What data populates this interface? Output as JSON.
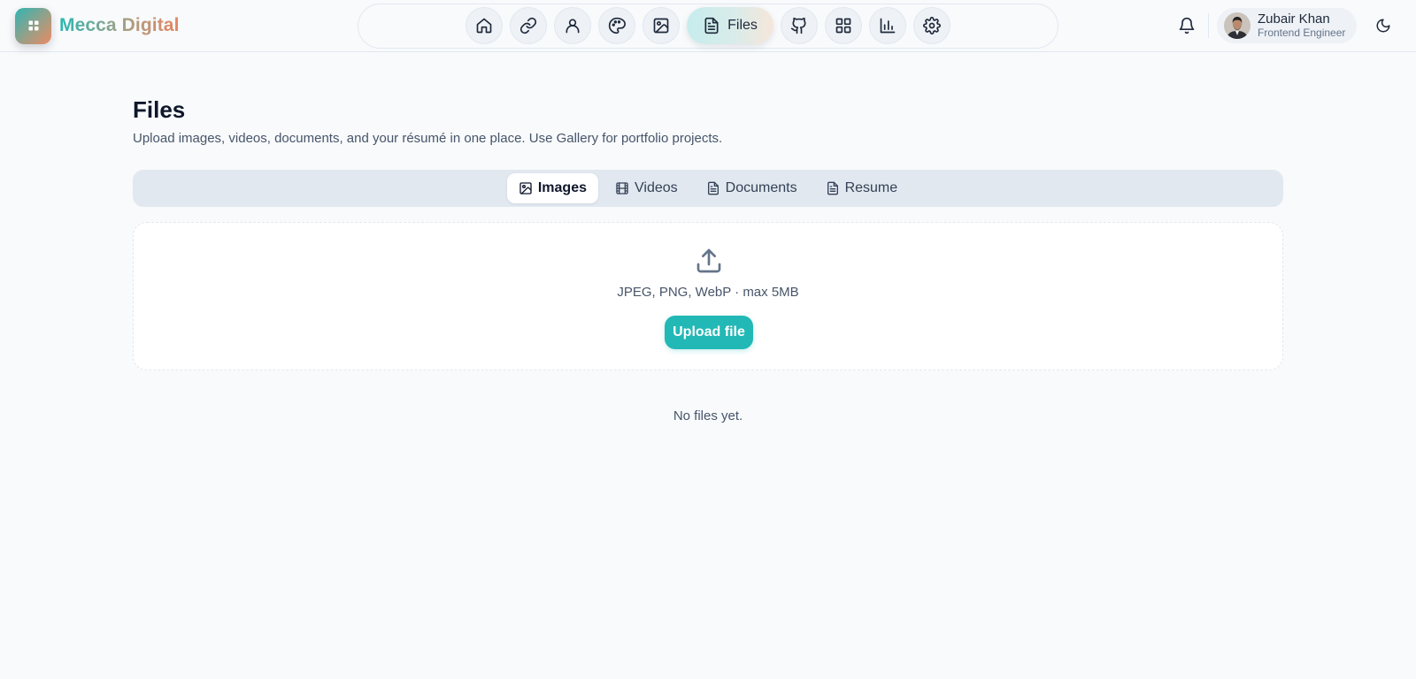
{
  "brand": {
    "name": "Mecca Digital",
    "logo_icon": "grid-icon"
  },
  "nav": {
    "items": [
      {
        "icon": "home-icon",
        "label": ""
      },
      {
        "icon": "link-icon",
        "label": ""
      },
      {
        "icon": "user-icon",
        "label": ""
      },
      {
        "icon": "palette-icon",
        "label": ""
      },
      {
        "icon": "image-icon",
        "label": ""
      },
      {
        "icon": "file-icon",
        "label": "Files",
        "active": true
      },
      {
        "icon": "github-icon",
        "label": ""
      },
      {
        "icon": "grid-icon",
        "label": ""
      },
      {
        "icon": "bar-chart-icon",
        "label": ""
      },
      {
        "icon": "gear-icon",
        "label": ""
      }
    ]
  },
  "header": {
    "notifications_icon": "bell-icon",
    "theme_toggle_icon": "moon-icon",
    "user": {
      "name": "Zubair Khan",
      "role": "Frontend Engineer"
    }
  },
  "page": {
    "title": "Files",
    "subtitle": "Upload images, videos, documents, and your résumé in one place. Use Gallery for portfolio projects."
  },
  "tabs": [
    {
      "label": "Images",
      "icon": "image-icon",
      "active": true
    },
    {
      "label": "Videos",
      "icon": "film-icon"
    },
    {
      "label": "Documents",
      "icon": "document-icon"
    },
    {
      "label": "Resume",
      "icon": "document-icon"
    }
  ],
  "upload": {
    "icon": "upload-icon",
    "hint": "JPEG, PNG, WebP · max 5MB",
    "button_label": "Upload file"
  },
  "empty_state": "No files yet.",
  "colors": {
    "accent": "#22b8b5",
    "background": "#f8fafc",
    "brand_gradient_start": "#2bb7b3",
    "brand_gradient_end": "#e8845f"
  }
}
